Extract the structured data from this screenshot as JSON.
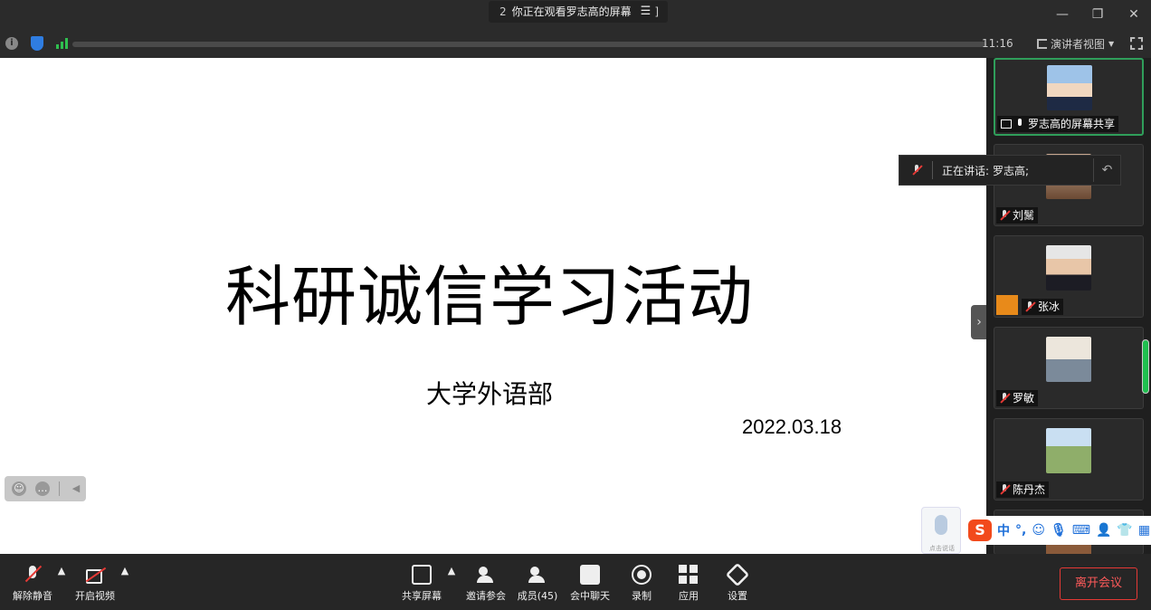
{
  "titlebar": {
    "prefix": "2",
    "viewing_text": "你正在观看罗志高的屏幕",
    "menu_icon": "list-menu-icon",
    "suffix": "]"
  },
  "info": {
    "time": "11:16",
    "view_mode": "演讲者视图"
  },
  "slide": {
    "title": "科研诚信学习活动",
    "subtitle": "大学外语部",
    "date": "2022.03.18"
  },
  "speaking": {
    "prefix": "正在讲话:",
    "name": "罗志高;"
  },
  "participants": [
    {
      "name": "罗志高的屏幕共享",
      "avatar": "person-photo"
    },
    {
      "name": "刘鬗",
      "avatar": "person-photo"
    },
    {
      "name": "张冰",
      "avatar": "person-photo"
    },
    {
      "name": "罗敏",
      "avatar": "person-photo"
    },
    {
      "name": "陈丹杰",
      "avatar": "person-photo"
    }
  ],
  "voice_input": {
    "caption": "点击说话"
  },
  "ime": {
    "logo": "S",
    "mode": "中",
    "punct": "°,"
  },
  "toolbar": {
    "unmute": "解除静音",
    "start_video": "开启视频",
    "share_screen": "共享屏幕",
    "invite": "邀请参会",
    "members": "成员(45)",
    "chat": "会中聊天",
    "record": "录制",
    "apps": "应用",
    "settings": "设置",
    "leave": "离开会议"
  },
  "colors": {
    "accent_green": "#2f9e5a",
    "leave_red": "#e53935",
    "host_orange": "#e88a1a"
  }
}
